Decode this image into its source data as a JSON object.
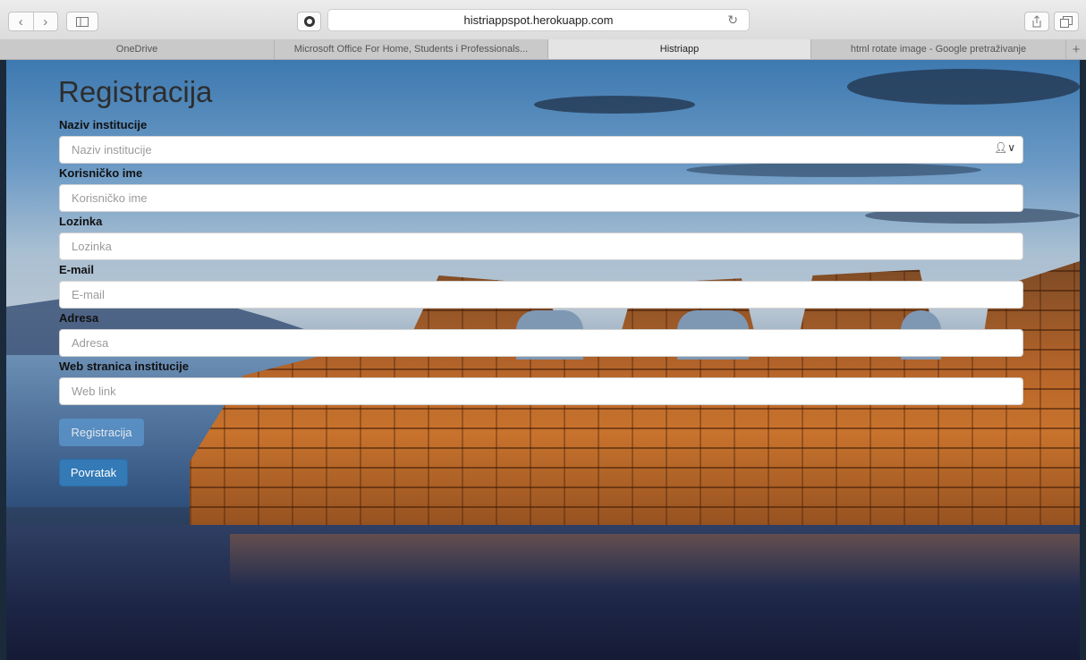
{
  "browser": {
    "url": "histriappspot.herokuapp.com",
    "tabs": [
      {
        "label": "OneDrive",
        "active": false
      },
      {
        "label": "Microsoft Office For Home, Students i Professionals...",
        "active": false
      },
      {
        "label": "Histriapp",
        "active": true
      },
      {
        "label": "html rotate image - Google pretraživanje",
        "active": false
      }
    ],
    "icons": {
      "back": "back-icon",
      "forward": "forward-icon",
      "sidebar": "sidebar-icon",
      "extension": "extension-icon",
      "reload": "reload-icon",
      "share": "share-icon",
      "tabs_overview": "tabs-overview-icon",
      "new_tab": "new-tab-icon"
    }
  },
  "form": {
    "title": "Registracija",
    "fields": [
      {
        "label": "Naziv institucije",
        "placeholder": "Naziv institucije",
        "value": ""
      },
      {
        "label": "Korisničko ime",
        "placeholder": "Korisničko ime",
        "value": ""
      },
      {
        "label": "Lozinka",
        "placeholder": "Lozinka",
        "value": ""
      },
      {
        "label": "E-mail",
        "placeholder": "E-mail",
        "value": ""
      },
      {
        "label": "Adresa",
        "placeholder": "Adresa",
        "value": ""
      },
      {
        "label": "Web stranica institucije",
        "placeholder": "Web link",
        "value": ""
      }
    ],
    "register_button": "Registracija",
    "back_button": "Povratak"
  },
  "colors": {
    "primary_button": "#337ab7",
    "disabled_button": "#5a93c9"
  }
}
